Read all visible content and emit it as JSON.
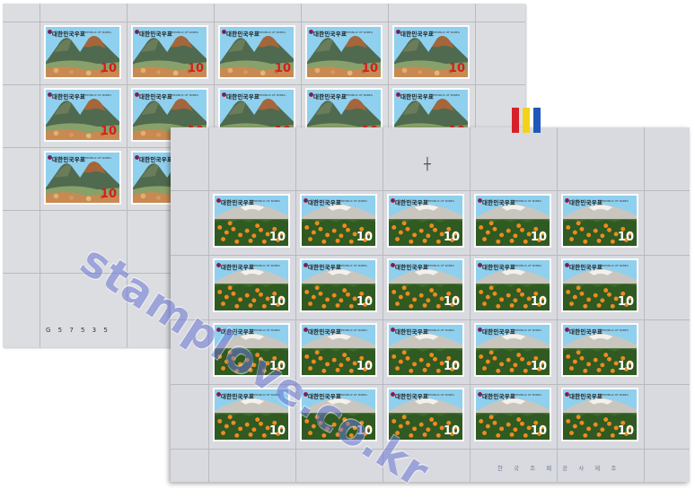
{
  "stamp": {
    "country_korean": "대한민국우표",
    "country_english": "REPUBLIC OF KOREA",
    "value": "10"
  },
  "sheet_back": {
    "rows": 4,
    "cols": 5,
    "visible_stamps": 12,
    "serial": "G 5 7 5 3 5"
  },
  "sheet_front": {
    "rows": 4,
    "cols": 5,
    "visible_stamps": 20,
    "printer_imprint": "한 국 조 폐 공 사 제 조"
  },
  "colors": {
    "sheet": "#dcdde1",
    "stamp_sky": "#8fd0ee",
    "mountain": "#4f6a4f",
    "orchard": "#3d6b2a",
    "orange_fruit": "#ef8a1f",
    "color_bars": [
      "#d6202a",
      "#f4d21a",
      "#1f58b8"
    ]
  },
  "watermark": "stamplove.co.kr"
}
